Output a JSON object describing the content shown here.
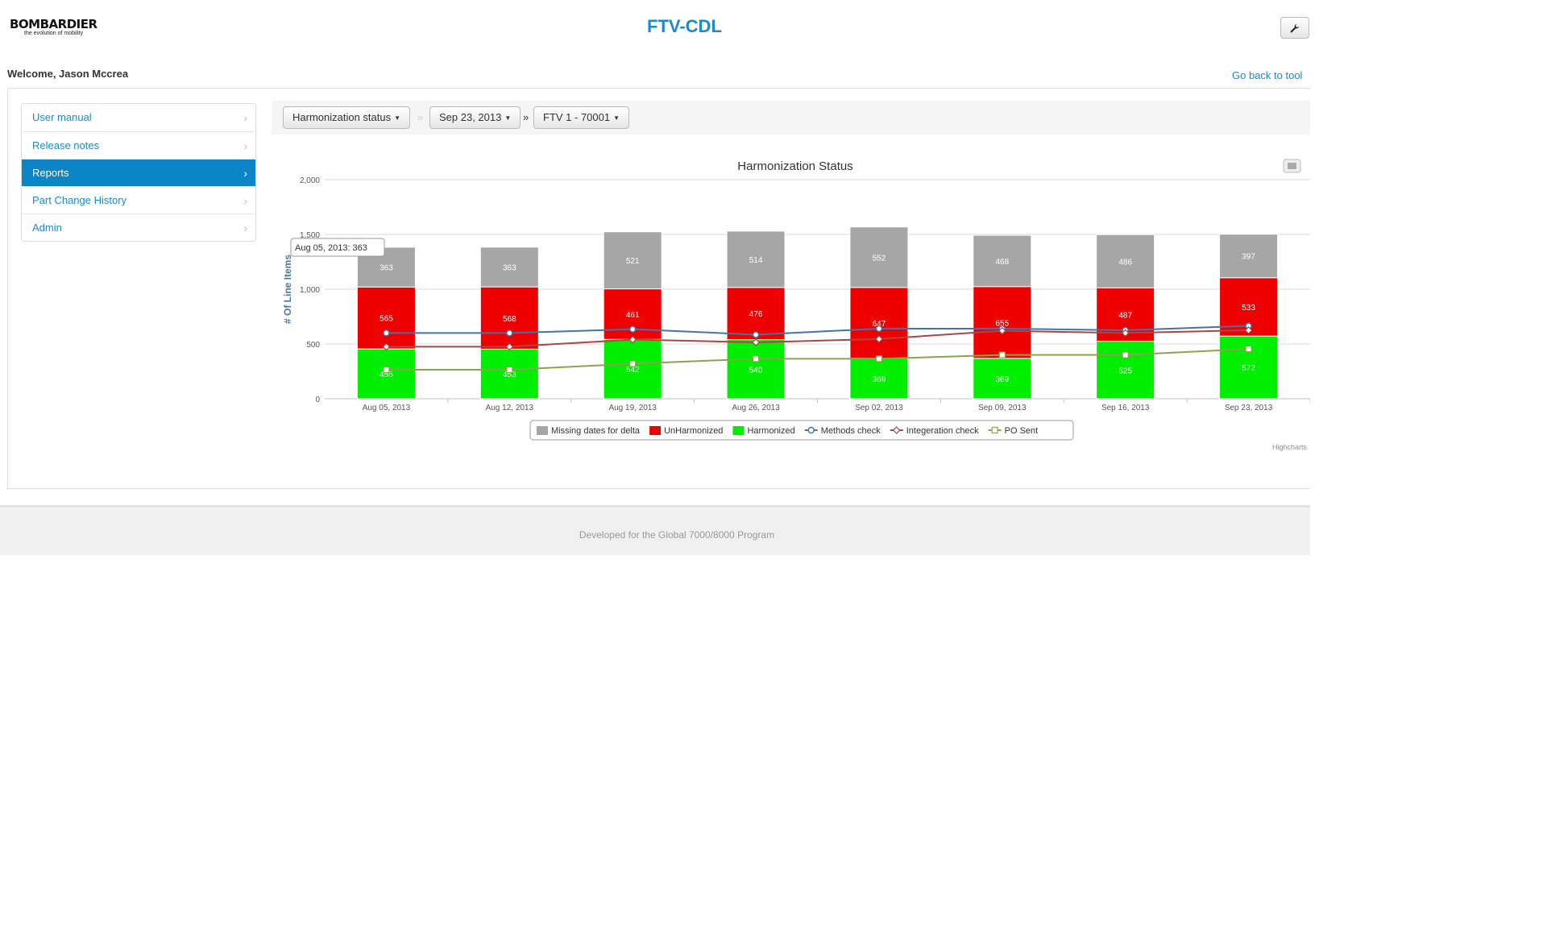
{
  "header": {
    "logo_text": "BOMBARDIER",
    "logo_tagline": "the evolution of mobility",
    "app_title": "FTV-CDL",
    "tool_icon": "wrench-icon"
  },
  "welcome": "Welcome, Jason Mccrea",
  "back_link": "Go back to tool",
  "sidebar": {
    "items": [
      {
        "label": "User manual",
        "active": false
      },
      {
        "label": "Release notes",
        "active": false
      },
      {
        "label": "Reports",
        "active": true
      },
      {
        "label": "Part Change History",
        "active": false
      },
      {
        "label": "Admin",
        "active": false
      }
    ],
    "chevron": "›"
  },
  "filters": {
    "report": "Harmonization status",
    "sep1": "»",
    "date": "Sep 23, 2013",
    "sep2": "»",
    "vehicle": "FTV 1 - 70001"
  },
  "tooltip": "Aug 05, 2013: 363",
  "credits": "Highcharts",
  "footer_text": "Developed for the Global 7000/8000 Program",
  "colors": {
    "accent": "#1a8bc8",
    "active_nav": "#0c85c6"
  },
  "chart_data": {
    "type": "bar",
    "title": "Harmonization Status",
    "ylabel": "# Of Line Items",
    "ylim": [
      0,
      2000
    ],
    "yticks": [
      "0",
      "500",
      "1,000",
      "1,500",
      "2,000"
    ],
    "categories": [
      "Aug 05, 2013",
      "Aug 12, 2013",
      "Aug 19, 2013",
      "Aug 26, 2013",
      "Sep 02, 2013",
      "Sep 09, 2013",
      "Sep 16, 2013",
      "Sep 23, 2013"
    ],
    "stacked": true,
    "bar_series": [
      {
        "name": "Harmonized",
        "color": "#00ee00",
        "values": [
          455,
          453,
          542,
          540,
          369,
          369,
          525,
          572
        ]
      },
      {
        "name": "UnHarmonized",
        "color": "#ee0000",
        "values": [
          565,
          568,
          461,
          476,
          647,
          655,
          487,
          533
        ]
      },
      {
        "name": "Missing dates for delta",
        "color": "#a6a6a6",
        "values": [
          363,
          363,
          521,
          514,
          552,
          468,
          486,
          397
        ]
      }
    ],
    "line_series": [
      {
        "name": "Methods check",
        "color": "#4572a7",
        "values": [
          600,
          600,
          635,
          585,
          640,
          640,
          625,
          665
        ]
      },
      {
        "name": "Integeration check",
        "color": "#aa4643",
        "values": [
          475,
          475,
          540,
          515,
          545,
          620,
          600,
          625
        ]
      },
      {
        "name": "PO Sent",
        "color": "#89a54e",
        "values": [
          265,
          265,
          320,
          365,
          365,
          400,
          400,
          455
        ]
      }
    ],
    "legend_order": [
      "Missing dates for delta",
      "UnHarmonized",
      "Harmonized",
      "Methods check",
      "Integeration check",
      "PO Sent"
    ],
    "legend_position": "bottom-center",
    "grid": true
  }
}
